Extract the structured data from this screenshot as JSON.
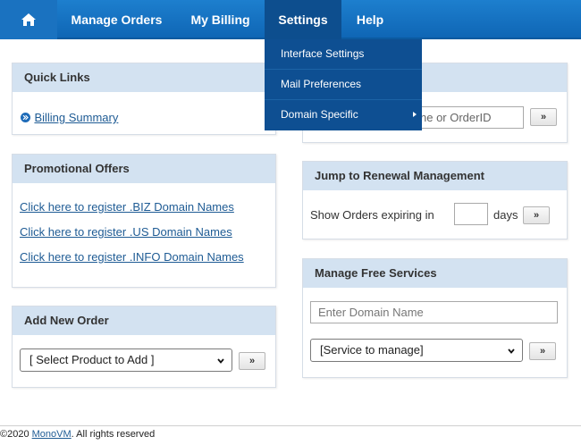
{
  "nav": {
    "home_icon": "home-icon",
    "items": [
      {
        "label": "Manage Orders"
      },
      {
        "label": "My Billing"
      },
      {
        "label": "Settings"
      },
      {
        "label": "Help"
      }
    ]
  },
  "settings_menu": {
    "items": [
      {
        "label": "Interface Settings"
      },
      {
        "label": "Mail Preferences"
      },
      {
        "label": "Domain Specific"
      }
    ]
  },
  "quick_links": {
    "title": "Quick Links",
    "link": "Billing Summary"
  },
  "promotional_offers": {
    "title": "Promotional Offers",
    "links": [
      "Click here to register .BIZ Domain Names",
      "Click here to register .US Domain Names",
      "Click here to register .INFO Domain Names"
    ]
  },
  "add_new_order": {
    "title": "Add New Order",
    "select_value": "[ Select Product to Add ]",
    "go": "»"
  },
  "search_orders": {
    "placeholder_visible": "ne or OrderID",
    "go": "»"
  },
  "renewal": {
    "title": "Jump to Renewal Management",
    "prefix": "Show Orders expiring in",
    "suffix": "days",
    "go": "»"
  },
  "free_services": {
    "title": "Manage Free Services",
    "domain_placeholder": "Enter Domain Name",
    "service_value": "[Service to manage]",
    "go": "»"
  },
  "footer": {
    "copyright": "©2020",
    "brand": "MonoVM",
    "rights": ". All rights reserved"
  },
  "colors": {
    "nav_blue": "#1a72c0",
    "menu_blue": "#0e4f92",
    "panel_header": "#d3e2f1",
    "link": "#1e5b94"
  }
}
